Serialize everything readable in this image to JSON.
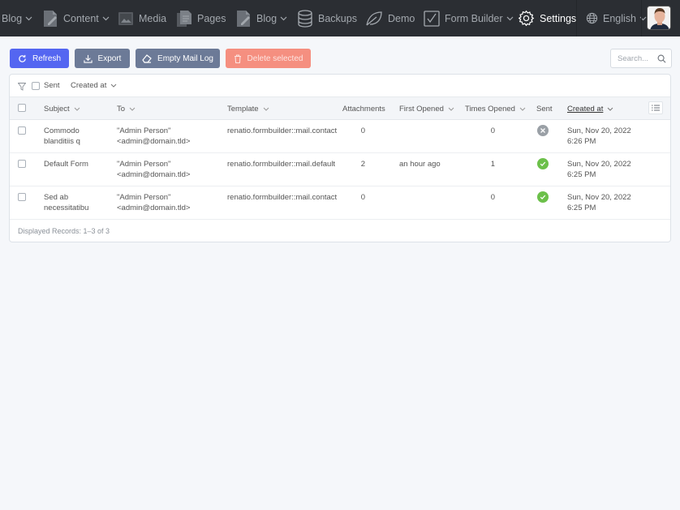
{
  "nav": {
    "items": [
      {
        "label": "Blog",
        "icon": "blog-icon",
        "dropdown": true
      },
      {
        "label": "Content",
        "icon": "content-icon",
        "dropdown": true
      },
      {
        "label": "Media",
        "icon": "media-icon",
        "dropdown": false
      },
      {
        "label": "Pages",
        "icon": "pages-icon",
        "dropdown": false
      },
      {
        "label": "Blog",
        "icon": "blog-icon",
        "dropdown": true
      },
      {
        "label": "Backups",
        "icon": "database-icon",
        "dropdown": false
      },
      {
        "label": "Demo",
        "icon": "leaf-icon",
        "dropdown": false
      },
      {
        "label": "Form Builder",
        "icon": "checkbox-icon",
        "dropdown": true
      },
      {
        "label": "Settings",
        "icon": "gear-icon",
        "dropdown": false,
        "active": true
      }
    ],
    "language": "English"
  },
  "toolbar": {
    "refresh": "Refresh",
    "export": "Export",
    "empty_log": "Empty Mail Log",
    "delete_selected": "Delete selected"
  },
  "search": {
    "placeholder": "Search..."
  },
  "filters": {
    "sent": "Sent",
    "created_at": "Created at"
  },
  "table": {
    "columns": {
      "subject": "Subject",
      "to": "To",
      "template": "Template",
      "attachments": "Attachments",
      "first_opened": "First Opened",
      "times_opened": "Times Opened",
      "sent": "Sent",
      "created_at": "Created at"
    },
    "rows": [
      {
        "subject_1": "Commodo",
        "subject_2": "blanditiis q",
        "to_1": "\"Admin Person\"",
        "to_2": "<admin@domain.tld>",
        "template": "renatio.formbuilder::mail.contact",
        "attachments": "0",
        "first_opened": "",
        "times_opened": "0",
        "sent": false,
        "created_1": "Sun, Nov 20, 2022",
        "created_2": "6:26 PM"
      },
      {
        "subject_1": "Default Form",
        "subject_2": "",
        "to_1": "\"Admin Person\"",
        "to_2": "<admin@domain.tld>",
        "template": "renatio.formbuilder::mail.default",
        "attachments": "2",
        "first_opened": "an hour ago",
        "times_opened": "1",
        "sent": true,
        "created_1": "Sun, Nov 20, 2022",
        "created_2": "6:25 PM"
      },
      {
        "subject_1": "Sed ab",
        "subject_2": "necessitatibu",
        "to_1": "\"Admin Person\"",
        "to_2": "<admin@domain.tld>",
        "template": "renatio.formbuilder::mail.contact",
        "attachments": "0",
        "first_opened": "",
        "times_opened": "0",
        "sent": true,
        "created_1": "Sun, Nov 20, 2022",
        "created_2": "6:25 PM"
      }
    ]
  },
  "footer": {
    "records": "Displayed Records: 1–3 of 3"
  },
  "colors": {
    "primary": "#5466f1",
    "secondary": "#6c7a97",
    "danger": "#f58f80",
    "success": "#6cc04a",
    "nav_bg": "#2b2e33"
  }
}
